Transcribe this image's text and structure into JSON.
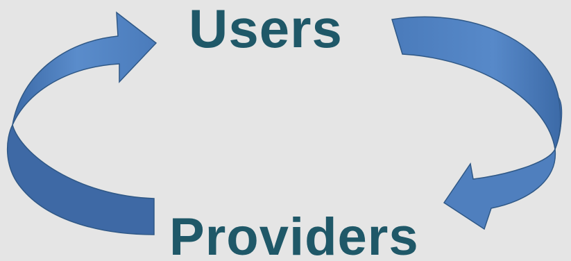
{
  "diagram": {
    "top_node": "Users",
    "bottom_node": "Providers",
    "colors": {
      "background": "#e5e5e5",
      "label": "#1f5868",
      "arrow_fill": "#4f7fbe",
      "arrow_shadow": "#3f6aa6",
      "arrow_outline": "#2f5886"
    }
  }
}
